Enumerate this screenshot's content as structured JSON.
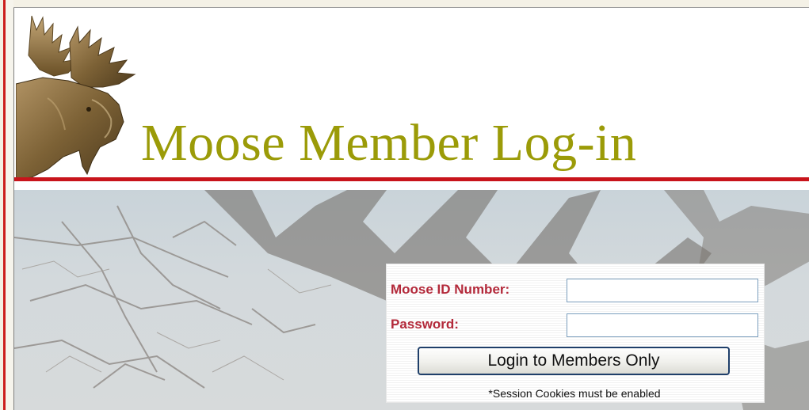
{
  "page": {
    "title": "Moose Member Log-in"
  },
  "login": {
    "id_label": "Moose ID Number:",
    "id_value": "",
    "password_label": "Password:",
    "password_value": "",
    "submit_label": "Login to Members Only",
    "note": "*Session Cookies must be enabled"
  },
  "colors": {
    "title": "#9b9b08",
    "rule": "#c8141b",
    "label": "#b3293a",
    "button_border": "#1f3f6a"
  },
  "icons": {
    "logo": "moose-head-icon",
    "background": "moose-antler-photo"
  }
}
